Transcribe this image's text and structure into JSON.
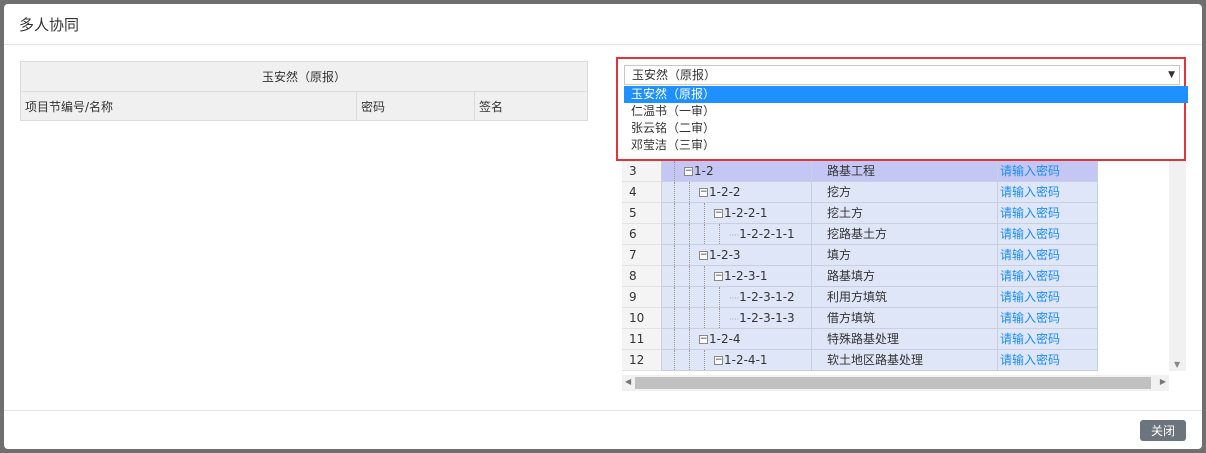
{
  "modal": {
    "title": "多人协同",
    "close_label": "关闭"
  },
  "left_table": {
    "group_header": "玉安然（原报）",
    "columns": [
      "项目节编号/名称",
      "密码",
      "签名"
    ]
  },
  "reviewer_select": {
    "value": "玉安然（原报）",
    "options": [
      "玉安然（原报）",
      "仁温书（一审）",
      "张云铭（二审）",
      "邓莹洁（三审）"
    ],
    "selected_index": 0
  },
  "tree_rows": [
    {
      "num": "3",
      "code": "1-2",
      "name": "路基工程",
      "action": "请输入密码",
      "level": 0,
      "toggle": true,
      "highlight": true
    },
    {
      "num": "4",
      "code": "1-2-2",
      "name": "挖方",
      "action": "请输入密码",
      "level": 1,
      "toggle": true
    },
    {
      "num": "5",
      "code": "1-2-2-1",
      "name": "挖土方",
      "action": "请输入密码",
      "level": 2,
      "toggle": true
    },
    {
      "num": "6",
      "code": "1-2-2-1-1",
      "name": "挖路基土方",
      "action": "请输入密码",
      "level": 3,
      "toggle": false
    },
    {
      "num": "7",
      "code": "1-2-3",
      "name": "填方",
      "action": "请输入密码",
      "level": 1,
      "toggle": true
    },
    {
      "num": "8",
      "code": "1-2-3-1",
      "name": "路基填方",
      "action": "请输入密码",
      "level": 2,
      "toggle": true
    },
    {
      "num": "9",
      "code": "1-2-3-1-2",
      "name": "利用方填筑",
      "action": "请输入密码",
      "level": 3,
      "toggle": false
    },
    {
      "num": "10",
      "code": "1-2-3-1-3",
      "name": "借方填筑",
      "action": "请输入密码",
      "level": 3,
      "toggle": false
    },
    {
      "num": "11",
      "code": "1-2-4",
      "name": "特殊路基处理",
      "action": "请输入密码",
      "level": 1,
      "toggle": true
    },
    {
      "num": "12",
      "code": "1-2-4-1",
      "name": "软土地区路基处理",
      "action": "请输入密码",
      "level": 2,
      "toggle": true
    }
  ],
  "colors": {
    "accent_red": "#e1343f",
    "selected_blue": "#1e90ff",
    "link_blue": "#1a8cff",
    "button_gray": "#6c757d"
  }
}
